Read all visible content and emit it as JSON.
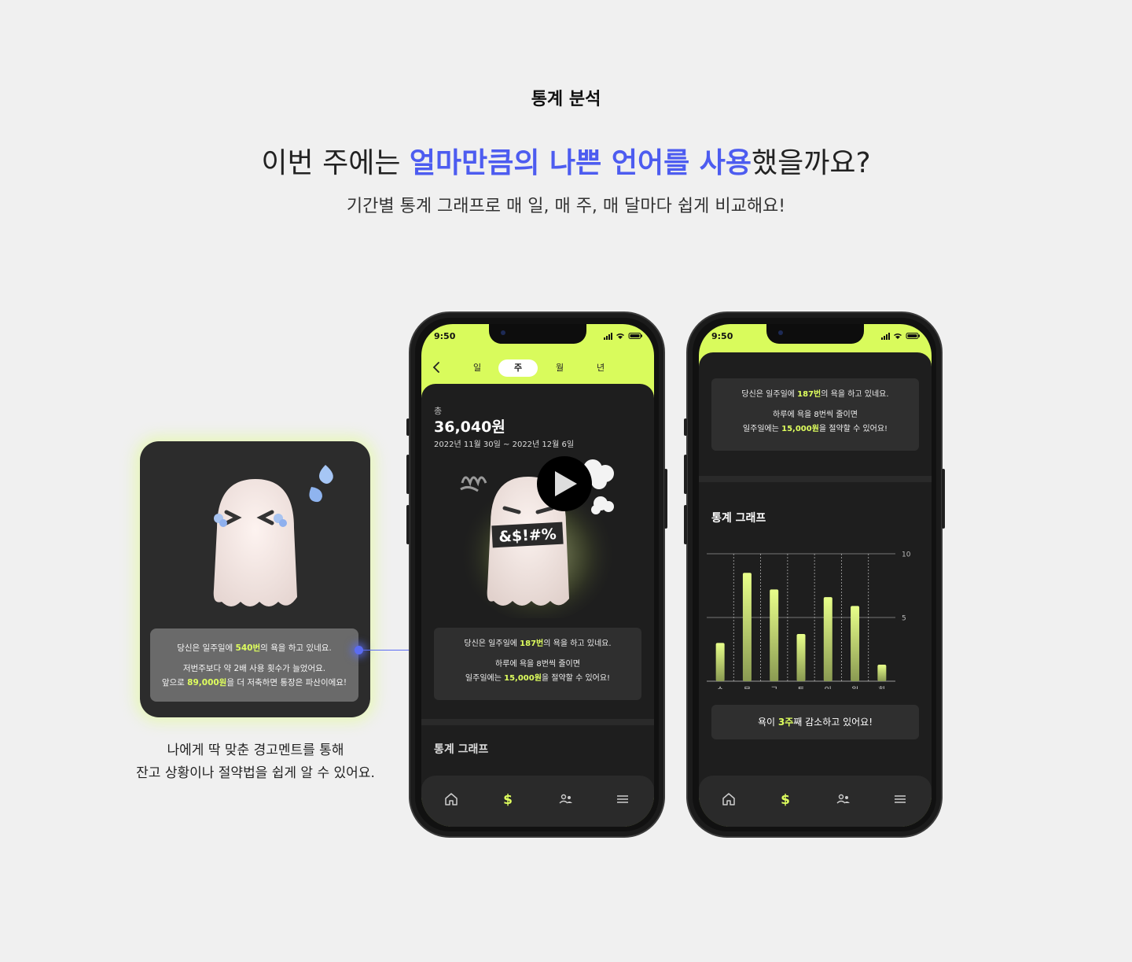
{
  "hero": {
    "eyebrow": "통계 분석",
    "headline_pre": "이번 주에는 ",
    "headline_accent": "얼마만큼의 나쁜 언어를 사용",
    "headline_post": "했을까요?",
    "subline": "기간별 통계 그래프로 매 일, 매 주, 매 달마다 쉽게 비교해요!"
  },
  "warning_card": {
    "line1_pre": "당신은 일주일에 ",
    "line1_hl": "540번",
    "line1_post": "의 욕을 하고 있네요.",
    "line2": "저번주보다 약 2배 사용 횟수가 늘었어요.",
    "line3_pre": "앞으로 ",
    "line3_hl": "89,000원",
    "line3_post": "을 더 저축하면 통장은 파산이에요!",
    "caption_line1": "나에게 딱 맞춘 경고멘트를 통해",
    "caption_line2": "잔고 상황이나 절약법을 쉽게 알 수 있어요.",
    "accent_color": "#dfff5e",
    "connector_color": "#5b6cf2"
  },
  "phone1": {
    "status_time": "9:50",
    "tabs": [
      {
        "label": "일",
        "active": false
      },
      {
        "label": "주",
        "active": true
      },
      {
        "label": "월",
        "active": false
      },
      {
        "label": "년",
        "active": false
      }
    ],
    "total_label": "총",
    "total_amount": "36,040원",
    "date_range": "2022년 11월 30일 ~ 2022년 12월 6일",
    "ghost_text": "&$!#%",
    "stat_line1_pre": "당신은 일주일에 ",
    "stat_line1_hl": "187번",
    "stat_line1_post": "의 욕을 하고 있네요.",
    "stat_line2": "하루에 욕을 8번씩 줄이면",
    "stat_line3_pre": "일주일에는 ",
    "stat_line3_hl": "15,000원",
    "stat_line3_post": "을 절약할 수 있어요!",
    "section_title": "통계 그래프",
    "nav": [
      "home-icon",
      "dollar-icon",
      "users-icon",
      "menu-icon"
    ]
  },
  "phone2": {
    "status_time": "9:50",
    "stat_line1_pre": "당신은 일주일에 ",
    "stat_line1_hl": "187번",
    "stat_line1_post": "의 욕을 하고 있네요.",
    "stat_line2": "하루에 욕을 8번씩 줄이면",
    "stat_line3_pre": "일주일에는 ",
    "stat_line3_hl": "15,000원",
    "stat_line3_post": "을 절약할 수 있어요!",
    "section_title": "통계 그래프",
    "trend_pre": "욕이 ",
    "trend_hl": "3주",
    "trend_post": "째 감소하고 있어요!"
  },
  "chart_data": {
    "type": "bar",
    "categories": [
      "수",
      "목",
      "금",
      "토",
      "일",
      "월",
      "화"
    ],
    "values": [
      3,
      8.5,
      7.2,
      3.7,
      6.6,
      5.9,
      1.3
    ],
    "ylim": [
      0,
      10
    ],
    "yticks": [
      "5",
      "10"
    ],
    "grid": true,
    "bar_color_top": "#e8ff8a",
    "bar_color_bottom": "#8a9a52"
  }
}
